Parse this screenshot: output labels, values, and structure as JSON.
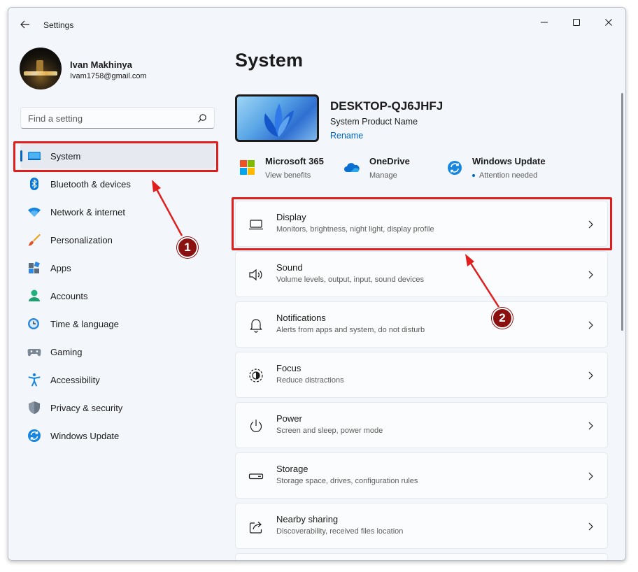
{
  "window": {
    "title": "Settings"
  },
  "profile": {
    "name": "Ivan Makhinya",
    "email": "Ivam1758@gmail.com"
  },
  "search": {
    "placeholder": "Find a setting"
  },
  "sidebar": {
    "items": [
      {
        "label": "System",
        "icon": "system-display-icon",
        "selected": true
      },
      {
        "label": "Bluetooth & devices",
        "icon": "bluetooth-icon"
      },
      {
        "label": "Network & internet",
        "icon": "wifi-icon"
      },
      {
        "label": "Personalization",
        "icon": "paintbrush-icon"
      },
      {
        "label": "Apps",
        "icon": "apps-icon"
      },
      {
        "label": "Accounts",
        "icon": "person-icon"
      },
      {
        "label": "Time & language",
        "icon": "clock-globe-icon"
      },
      {
        "label": "Gaming",
        "icon": "gamepad-icon"
      },
      {
        "label": "Accessibility",
        "icon": "accessibility-icon"
      },
      {
        "label": "Privacy & security",
        "icon": "shield-icon"
      },
      {
        "label": "Windows Update",
        "icon": "update-icon"
      }
    ]
  },
  "main": {
    "title": "System",
    "device": {
      "name": "DESKTOP-QJ6JHFJ",
      "model": "System Product Name",
      "rename": "Rename"
    },
    "quick_links": [
      {
        "title": "Microsoft 365",
        "subtitle": "View benefits",
        "icon": "microsoft-logo-icon"
      },
      {
        "title": "OneDrive",
        "subtitle": "Manage",
        "icon": "onedrive-cloud-icon"
      },
      {
        "title": "Windows Update",
        "subtitle": "Attention needed",
        "icon": "update-icon"
      }
    ],
    "cards": [
      {
        "title": "Display",
        "subtitle": "Monitors, brightness, night light, display profile",
        "icon": "monitor-icon"
      },
      {
        "title": "Sound",
        "subtitle": "Volume levels, output, input, sound devices",
        "icon": "speaker-icon"
      },
      {
        "title": "Notifications",
        "subtitle": "Alerts from apps and system, do not disturb",
        "icon": "bell-icon"
      },
      {
        "title": "Focus",
        "subtitle": "Reduce distractions",
        "icon": "focus-icon"
      },
      {
        "title": "Power",
        "subtitle": "Screen and sleep, power mode",
        "icon": "power-icon"
      },
      {
        "title": "Storage",
        "subtitle": "Storage space, drives, configuration rules",
        "icon": "drive-icon"
      },
      {
        "title": "Nearby sharing",
        "subtitle": "Discoverability, received files location",
        "icon": "share-icon"
      }
    ]
  },
  "annotations": {
    "badge_1": "1",
    "badge_2": "2",
    "highlight_color": "#e01e1e",
    "badge_color": "#8b1010"
  },
  "colors": {
    "accent": "#0067c0",
    "window_bg": "#f3f6fb",
    "card_bg": "#fbfcfd"
  }
}
